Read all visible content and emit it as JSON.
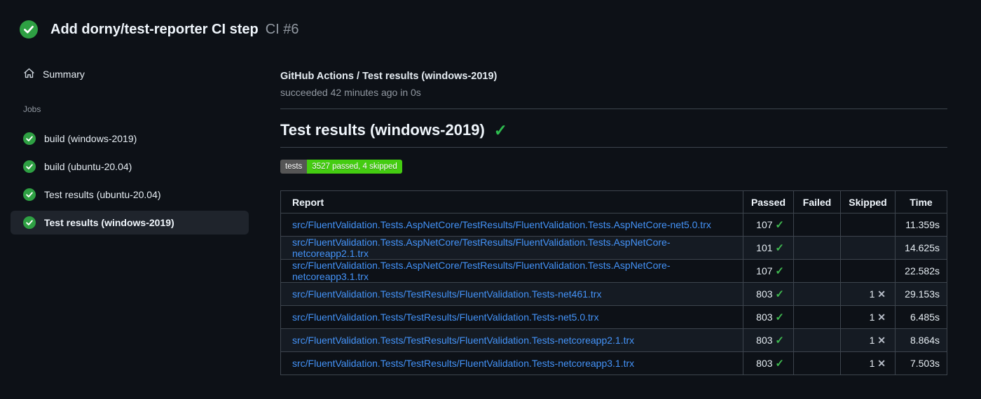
{
  "colors": {
    "page_bg": "#0d1117",
    "success_green": "#2ea043",
    "check_green": "#3fb950",
    "link_blue": "#4493f8",
    "muted_text": "#9198a1",
    "border": "#3d444d",
    "row_alt_bg": "#151b23",
    "selected_item_bg": "#1f242c",
    "badge_label_bg": "#555555",
    "badge_value_bg": "#44cc11"
  },
  "header": {
    "title": "Add dorny/test-reporter CI step",
    "run_ref": "CI #6",
    "status_icon": "check-circle"
  },
  "sidebar": {
    "summary_label": "Summary",
    "summary_icon": "home",
    "jobs_label": "Jobs",
    "jobs": [
      {
        "label": "build (windows-2019)",
        "status": "success",
        "selected": false
      },
      {
        "label": "build (ubuntu-20.04)",
        "status": "success",
        "selected": false
      },
      {
        "label": "Test results (ubuntu-20.04)",
        "status": "success",
        "selected": false
      },
      {
        "label": "Test results (windows-2019)",
        "status": "success",
        "selected": true
      }
    ]
  },
  "main": {
    "check_title": "GitHub Actions / Test results (windows-2019)",
    "check_status": "succeeded 42 minutes ago in 0s",
    "section_title": "Test results (windows-2019)",
    "section_status_icon": "check",
    "badge": {
      "label": "tests",
      "value": "3527 passed, 4 skipped"
    },
    "table": {
      "headers": [
        "Report",
        "Passed",
        "Failed",
        "Skipped",
        "Time"
      ],
      "pass_icon": "check",
      "skip_icon": "x",
      "rows": [
        {
          "report": "src/FluentValidation.Tests.AspNetCore/TestResults/FluentValidation.Tests.AspNetCore-net5.0.trx",
          "passed": "107",
          "failed": "",
          "skipped": "",
          "time": "11.359s"
        },
        {
          "report": "src/FluentValidation.Tests.AspNetCore/TestResults/FluentValidation.Tests.AspNetCore-netcoreapp2.1.trx",
          "passed": "101",
          "failed": "",
          "skipped": "",
          "time": "14.625s"
        },
        {
          "report": "src/FluentValidation.Tests.AspNetCore/TestResults/FluentValidation.Tests.AspNetCore-netcoreapp3.1.trx",
          "passed": "107",
          "failed": "",
          "skipped": "",
          "time": "22.582s"
        },
        {
          "report": "src/FluentValidation.Tests/TestResults/FluentValidation.Tests-net461.trx",
          "passed": "803",
          "failed": "",
          "skipped": "1",
          "time": "29.153s"
        },
        {
          "report": "src/FluentValidation.Tests/TestResults/FluentValidation.Tests-net5.0.trx",
          "passed": "803",
          "failed": "",
          "skipped": "1",
          "time": "6.485s"
        },
        {
          "report": "src/FluentValidation.Tests/TestResults/FluentValidation.Tests-netcoreapp2.1.trx",
          "passed": "803",
          "failed": "",
          "skipped": "1",
          "time": "8.864s"
        },
        {
          "report": "src/FluentValidation.Tests/TestResults/FluentValidation.Tests-netcoreapp3.1.trx",
          "passed": "803",
          "failed": "",
          "skipped": "1",
          "time": "7.503s"
        }
      ]
    }
  }
}
